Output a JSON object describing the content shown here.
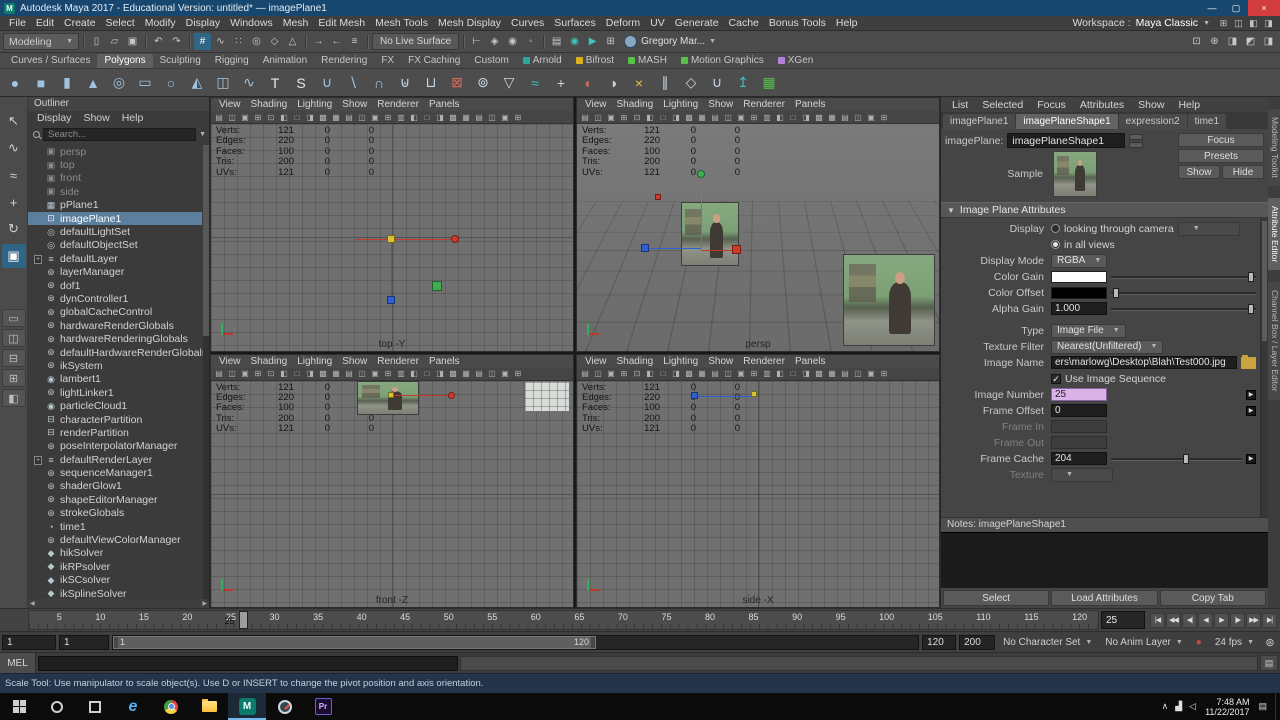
{
  "title_bar": {
    "title": "Autodesk Maya 2017 - Educational Version: untitled* — imagePlane1",
    "buttons": [
      {
        "name": "minimize-icon"
      },
      {
        "name": "maximize-icon"
      },
      {
        "name": "close-icon",
        "close": true
      }
    ]
  },
  "menu_bar": {
    "items": [
      "File",
      "Edit",
      "Create",
      "Select",
      "Modify",
      "Display",
      "Windows",
      "Mesh",
      "Edit Mesh",
      "Mesh Tools",
      "Mesh Display",
      "Curves",
      "Surfaces",
      "Deform",
      "UV",
      "Generate",
      "Cache",
      "Bonus Tools",
      "Help"
    ],
    "workspace_label": "Workspace :",
    "workspace_value": "Maya Classic",
    "right_icons": [
      {
        "name": "workspace-options-icon"
      },
      {
        "name": "panel-layout-icon"
      },
      {
        "name": "outliner-toggle-icon"
      },
      {
        "name": "channel-box-toggle-icon"
      }
    ]
  },
  "status_line": {
    "mode": "Modeling",
    "file_icons": [
      {
        "name": "new-scene-icon"
      },
      {
        "name": "open-scene-icon"
      },
      {
        "name": "save-scene-icon"
      }
    ],
    "undo_icons": [
      {
        "name": "undo-icon"
      },
      {
        "name": "redo-icon"
      }
    ],
    "snap_icons": [
      {
        "name": "snap-to-grids-icon",
        "active": true
      },
      {
        "name": "snap-to-curves-icon"
      },
      {
        "name": "snap-to-points-icon"
      },
      {
        "name": "snap-to-projected-center-icon"
      },
      {
        "name": "snap-to-view-planes-icon"
      },
      {
        "name": "make-live-icon"
      }
    ],
    "history_icons": [
      {
        "name": "input-connections-icon"
      },
      {
        "name": "output-connections-icon"
      },
      {
        "name": "construction-history-icon"
      }
    ],
    "no_live_surface": "No Live Surface",
    "selection_icons": [
      {
        "name": "select-hierarchy-icon"
      },
      {
        "name": "select-object-icon"
      },
      {
        "name": "select-component-icon"
      },
      {
        "name": "highlight-selection-icon"
      }
    ],
    "render_icons": [
      {
        "name": "render-view-icon"
      },
      {
        "name": "render-current-frame-icon",
        "accent": true
      },
      {
        "name": "ipr-render-icon",
        "accent": true
      },
      {
        "name": "render-settings-icon"
      }
    ],
    "account_label": "Gregory Mar...",
    "right_icons": [
      {
        "name": "modeling-toolkit-toggle-icon"
      },
      {
        "name": "humanik-toggle-icon"
      },
      {
        "name": "attribute-editor-toggle-icon"
      },
      {
        "name": "tool-settings-toggle-icon"
      },
      {
        "name": "channel-box-toggle-icon"
      }
    ]
  },
  "shelf": {
    "tabs": [
      {
        "label": "Curves / Surfaces"
      },
      {
        "label": "Polygons",
        "active": true
      },
      {
        "label": "Sculpting"
      },
      {
        "label": "Rigging"
      },
      {
        "label": "Animation"
      },
      {
        "label": "Rendering"
      },
      {
        "label": "FX"
      },
      {
        "label": "FX Caching"
      },
      {
        "label": "Custom"
      },
      {
        "label": "Arnold",
        "dot": "#2aa8a0"
      },
      {
        "label": "Bifrost",
        "dot": "#d8b21a"
      },
      {
        "label": "MASH",
        "dot": "#57c04a"
      },
      {
        "label": "Motion Graphics",
        "dot": "#57c04a"
      },
      {
        "label": "XGen",
        "dot": "#b780d8"
      }
    ],
    "icons": [
      {
        "name": "poly-sphere-icon",
        "color": "#9fc3e0"
      },
      {
        "name": "poly-cube-icon",
        "color": "#9fc3e0"
      },
      {
        "name": "poly-cylinder-icon",
        "color": "#9fc3e0"
      },
      {
        "name": "poly-cone-icon",
        "color": "#9fc3e0"
      },
      {
        "name": "poly-torus-icon",
        "color": "#9fc3e0"
      },
      {
        "name": "poly-plane-icon",
        "color": "#9fc3e0"
      },
      {
        "name": "poly-disc-icon",
        "color": "#9fc3e0"
      },
      {
        "name": "poly-pyramid-icon",
        "color": "#9fc3e0"
      },
      {
        "name": "poly-pipe-icon",
        "color": "#9fc3e0"
      },
      {
        "name": "poly-helix-icon",
        "color": "#9fc3e0"
      },
      {
        "name": "type-tool-icon",
        "color": "#e8e8e8"
      },
      {
        "name": "svg-tool-icon",
        "color": "#e8e8e8"
      },
      {
        "name": "boolean-union-icon",
        "color": "#9fc3e0"
      },
      {
        "name": "boolean-difference-icon",
        "color": "#9fc3e0"
      },
      {
        "name": "boolean-intersection-icon",
        "color": "#9fc3e0"
      },
      {
        "name": "combine-icon",
        "color": "#c7d6e2"
      },
      {
        "name": "separate-icon",
        "color": "#c7d6e2"
      },
      {
        "name": "extract-icon",
        "color": "#d66a5a"
      },
      {
        "name": "fill-hole-icon",
        "color": "#c7d6e2"
      },
      {
        "name": "reduce-icon",
        "color": "#c7d6e2"
      },
      {
        "name": "smooth-icon",
        "color": "#3fc0b8"
      },
      {
        "name": "append-icon",
        "color": "#c7d6e2"
      },
      {
        "name": "sculpt-icon",
        "color": "#d66a5a"
      },
      {
        "name": "mirror-icon",
        "color": "#c7d6e2"
      },
      {
        "name": "multi-cut-icon",
        "color": "#e0c04a"
      },
      {
        "name": "insert-edge-loop-icon",
        "color": "#c7d6e2"
      },
      {
        "name": "bevel-icon",
        "color": "#c7d6e2"
      },
      {
        "name": "bridge-icon",
        "color": "#c7d6e2"
      },
      {
        "name": "extrude-icon",
        "color": "#3fc0b8"
      },
      {
        "name": "quad-draw-icon",
        "color": "#57c04a"
      }
    ]
  },
  "toolbox": {
    "tools": [
      {
        "name": "select-tool-icon"
      },
      {
        "name": "lasso-tool-icon"
      },
      {
        "name": "paint-select-tool-icon"
      },
      {
        "name": "move-tool-icon"
      },
      {
        "name": "rotate-tool-icon"
      },
      {
        "name": "scale-tool-icon",
        "active": true
      }
    ],
    "layouts": [
      {
        "name": "single-pane-layout-icon"
      },
      {
        "name": "two-pane-side-layout-icon"
      },
      {
        "name": "two-pane-stacked-layout-icon"
      },
      {
        "name": "four-pane-layout-icon"
      },
      {
        "name": "persp-outliner-layout-icon"
      }
    ]
  },
  "outliner": {
    "panel_title": "Outliner",
    "menus": [
      "Display",
      "Show",
      "Help"
    ],
    "search_placeholder": "Search...",
    "items": [
      {
        "label": "persp",
        "icon": "camera-icon",
        "muted": true
      },
      {
        "label": "top",
        "icon": "camera-icon",
        "muted": true
      },
      {
        "label": "front",
        "icon": "camera-icon",
        "muted": true
      },
      {
        "label": "side",
        "icon": "camera-icon",
        "muted": true
      },
      {
        "label": "pPlane1",
        "icon": "mesh-icon"
      },
      {
        "label": "imagePlane1",
        "icon": "image-plane-icon",
        "selected": true
      },
      {
        "label": "defaultLightSet",
        "icon": "set-icon"
      },
      {
        "label": "defaultObjectSet",
        "icon": "set-icon"
      },
      {
        "label": "defaultLayer",
        "icon": "layer-icon",
        "expandable": true
      },
      {
        "label": "layerManager",
        "icon": "node-icon"
      },
      {
        "label": "dof1",
        "icon": "node-icon"
      },
      {
        "label": "dynController1",
        "icon": "node-icon"
      },
      {
        "label": "globalCacheControl",
        "icon": "node-icon"
      },
      {
        "label": "hardwareRenderGlobals",
        "icon": "node-icon"
      },
      {
        "label": "hardwareRenderingGlobals",
        "icon": "node-icon"
      },
      {
        "label": "defaultHardwareRenderGlobals",
        "icon": "node-icon"
      },
      {
        "label": "ikSystem",
        "icon": "node-icon"
      },
      {
        "label": "lambert1",
        "icon": "material-icon"
      },
      {
        "label": "lightLinker1",
        "icon": "node-icon"
      },
      {
        "label": "particleCloud1",
        "icon": "material-icon"
      },
      {
        "label": "characterPartition",
        "icon": "partition-icon"
      },
      {
        "label": "renderPartition",
        "icon": "partition-icon"
      },
      {
        "label": "poseInterpolatorManager",
        "icon": "node-icon"
      },
      {
        "label": "defaultRenderLayer",
        "icon": "layer-icon",
        "expandable": true
      },
      {
        "label": "sequenceManager1",
        "icon": "node-icon"
      },
      {
        "label": "shaderGlow1",
        "icon": "node-icon"
      },
      {
        "label": "shapeEditorManager",
        "icon": "node-icon"
      },
      {
        "label": "strokeGlobals",
        "icon": "node-icon"
      },
      {
        "label": "time1",
        "icon": "time-icon"
      },
      {
        "label": "defaultViewColorManager",
        "icon": "node-icon"
      },
      {
        "label": "hikSolver",
        "icon": "solver-icon"
      },
      {
        "label": "ikRPsolver",
        "icon": "solver-icon"
      },
      {
        "label": "ikSCsolver",
        "icon": "solver-icon"
      },
      {
        "label": "ikSplineSolver",
        "icon": "solver-icon"
      }
    ]
  },
  "viewport_menus": [
    "View",
    "Shading",
    "Lighting",
    "Show",
    "Renderer",
    "Panels"
  ],
  "viewport_toolbar_icons": [
    {
      "name": "select-camera-icon"
    },
    {
      "name": "lock-camera-icon"
    },
    {
      "name": "camera-attributes-icon"
    },
    {
      "name": "bookmarks-icon"
    },
    {
      "name": "image-plane-icon"
    },
    {
      "name": "2d-pan-zoom-icon"
    },
    {
      "name": "grease-pencil-icon"
    },
    {
      "name": "grid-toggle-icon"
    },
    {
      "name": "film-gate-icon"
    },
    {
      "name": "resolution-gate-icon"
    },
    {
      "name": "gate-mask-icon"
    },
    {
      "name": "field-chart-icon"
    },
    {
      "name": "safe-action-icon"
    },
    {
      "name": "safe-title-icon"
    },
    {
      "name": "frame-all-icon"
    },
    {
      "name": "frame-selection-icon"
    },
    {
      "name": "lighting-toggle-icon"
    },
    {
      "name": "shadows-toggle-icon"
    },
    {
      "name": "ao-toggle-icon"
    },
    {
      "name": "motion-blur-toggle-icon"
    },
    {
      "name": "multisampling-toggle-icon"
    },
    {
      "name": "isolate-select-icon"
    },
    {
      "name": "xray-toggle-icon"
    },
    {
      "name": "wireframe-on-shaded-icon"
    }
  ],
  "viewport_stats": [
    {
      "label": "Verts:",
      "total": "121",
      "sel": "0",
      "c3": "0"
    },
    {
      "label": "Edges:",
      "total": "220",
      "sel": "0",
      "c3": "0"
    },
    {
      "label": "Faces:",
      "total": "100",
      "sel": "0",
      "c3": "0"
    },
    {
      "label": "Tris:",
      "total": "200",
      "sel": "0",
      "c3": "0"
    },
    {
      "label": "UVs:",
      "total": "121",
      "sel": "0",
      "c3": "0"
    }
  ],
  "viewports": [
    {
      "id": "top",
      "label": "top -Y"
    },
    {
      "id": "persp",
      "label": "persp"
    },
    {
      "id": "front",
      "label": "front -Z"
    },
    {
      "id": "side",
      "label": "side -X"
    }
  ],
  "attribute_editor": {
    "menus": [
      "List",
      "Selected",
      "Focus",
      "Attributes",
      "Show",
      "Help"
    ],
    "tabs": [
      {
        "label": "imagePlane1"
      },
      {
        "label": "imagePlaneShape1",
        "active": true
      },
      {
        "label": "expression2"
      },
      {
        "label": "time1"
      }
    ],
    "node_type_label": "imagePlane:",
    "node_name": "imagePlaneShape1",
    "focus_button": "Focus",
    "presets_button": "Presets",
    "show_button": "Show",
    "hide_button": "Hide",
    "sample_label": "Sample",
    "section_title": "Image Plane Attributes",
    "fields": {
      "display_label": "Display",
      "display_option1": "looking through camera",
      "display_option2": "in all views",
      "display_mode_label": "Display Mode",
      "display_mode_value": "RGBA",
      "color_gain_label": "Color Gain",
      "color_offset_label": "Color Offset",
      "alpha_gain_label": "Alpha Gain",
      "alpha_gain_value": "1.000",
      "type_label": "Type",
      "type_value": "Image File",
      "texture_filter_label": "Texture Filter",
      "texture_filter_value": "Nearest(Unfiltered)",
      "image_name_label": "Image Name",
      "image_name_value": "ers\\marlowg\\Desktop\\Blah\\Test000.jpg",
      "use_image_sequence_label": "Use Image Sequence",
      "image_number_label": "Image Number",
      "image_number_value": "25",
      "frame_offset_label": "Frame Offset",
      "frame_offset_value": "0",
      "frame_in_label": "Frame In",
      "frame_out_label": "Frame Out",
      "frame_cache_label": "Frame Cache",
      "frame_cache_value": "204",
      "texture_label": "Texture"
    },
    "notes_label": "Notes: imagePlaneShape1",
    "buttons": [
      "Select",
      "Load Attributes",
      "Copy Tab"
    ]
  },
  "right_strip": {
    "tabs": [
      {
        "label": "Modeling Toolkit"
      },
      {
        "label": "Attribute Editor",
        "active": true
      },
      {
        "label": "Channel Box / Layer Editor"
      }
    ]
  },
  "time_slider": {
    "ticks": [
      "5",
      "10",
      "15",
      "20",
      "25",
      "30",
      "35",
      "40",
      "45",
      "50",
      "55",
      "60",
      "65",
      "70",
      "75",
      "80",
      "85",
      "90",
      "95",
      "100",
      "105",
      "110",
      "115",
      "120"
    ],
    "current_frame": "25",
    "current_time_field": "25",
    "playback_buttons": [
      {
        "name": "go-to-start-icon"
      },
      {
        "name": "step-back-key-icon"
      },
      {
        "name": "step-back-frame-icon"
      },
      {
        "name": "play-backward-icon"
      },
      {
        "name": "play-forward-icon"
      },
      {
        "name": "step-forward-frame-icon"
      },
      {
        "name": "step-forward-key-icon"
      },
      {
        "name": "go-to-end-icon"
      }
    ]
  },
  "range_slider": {
    "animation_start": "1",
    "playback_start": "1",
    "range_label_start": "1",
    "range_label_end": "120",
    "playback_end": "120",
    "animation_end": "200",
    "character_set": "No Character Set",
    "anim_layer": "No Anim Layer",
    "fps": "24 fps"
  },
  "command_line": {
    "mel_label": "MEL"
  },
  "help_line": {
    "text": "Scale Tool: Use manipulator to scale object(s). Use D or INSERT to change the pivot position and axis orientation."
  },
  "taskbar": {
    "items": [
      {
        "name": "start-button-icon"
      },
      {
        "name": "cortana-search-icon"
      },
      {
        "name": "task-view-icon"
      },
      {
        "name": "edge-icon",
        "badge": "e"
      },
      {
        "name": "chrome-icon"
      },
      {
        "name": "file-explorer-icon"
      },
      {
        "name": "maya-taskbar-icon",
        "badge": "M",
        "active": true
      },
      {
        "name": "compass-app-icon"
      },
      {
        "name": "premiere-icon",
        "badge": "Pr"
      }
    ],
    "tray_icons": [
      {
        "name": "tray-expand-icon"
      },
      {
        "name": "network-tray-icon"
      },
      {
        "name": "volume-tray-icon"
      }
    ],
    "tray_time": "7:48 AM",
    "tray_date": "11/22/2017",
    "action_center": {
      "name": "action-center-icon"
    }
  }
}
